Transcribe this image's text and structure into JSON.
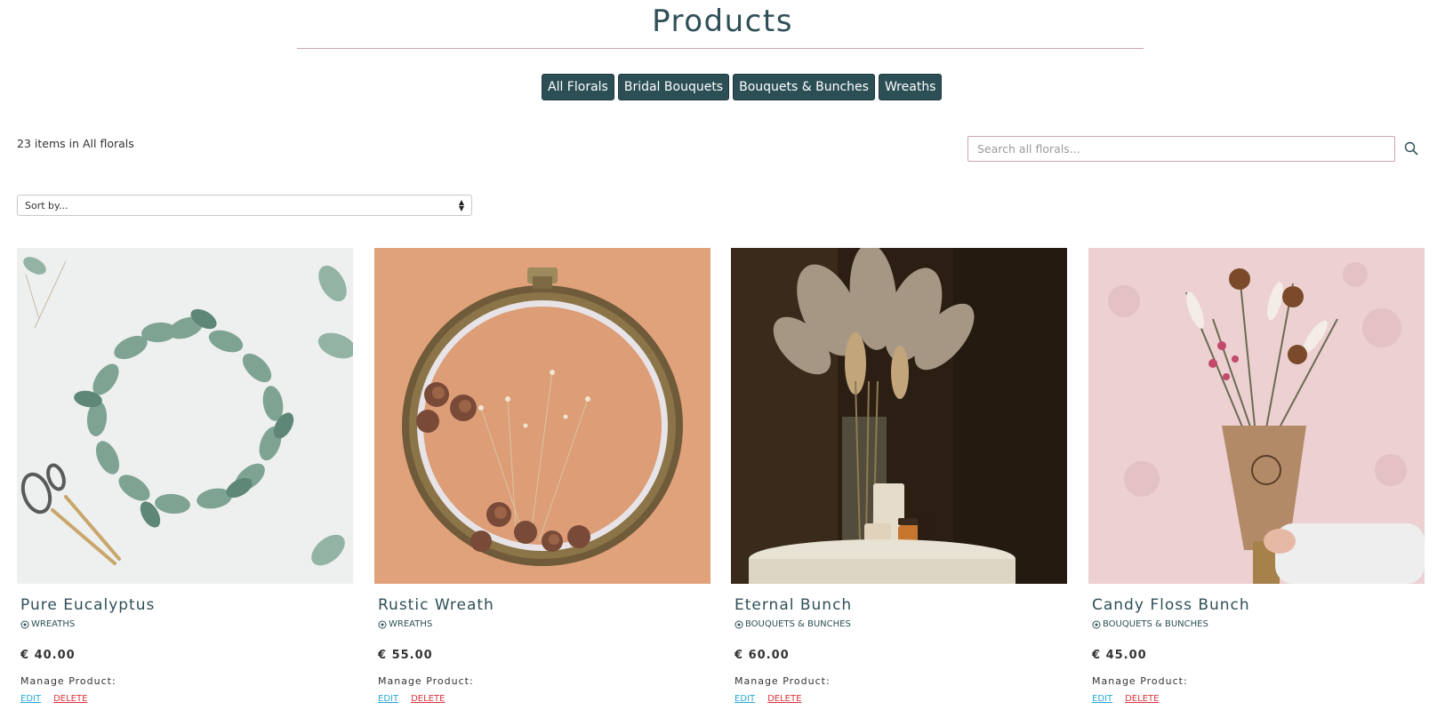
{
  "page": {
    "title": "Products"
  },
  "categories": [
    {
      "label": "All Florals"
    },
    {
      "label": "Bridal Bouquets"
    },
    {
      "label": "Bouquets & Bunches"
    },
    {
      "label": "Wreaths"
    }
  ],
  "toolbar": {
    "item_count_text": "23 items in All florals",
    "search_placeholder": "Search all florals...",
    "sort_label": "Sort by..."
  },
  "products": [
    {
      "name": "Pure Eucalyptus",
      "category": "WREATHS",
      "price": "€ 40.00",
      "manage_label": "Manage Product:",
      "edit_label": "EDIT",
      "delete_label": "DELETE"
    },
    {
      "name": "Rustic Wreath",
      "category": "WREATHS",
      "price": "€ 55.00",
      "manage_label": "Manage Product:",
      "edit_label": "EDIT",
      "delete_label": "DELETE"
    },
    {
      "name": "Eternal Bunch",
      "category": "BOUQUETS & BUNCHES",
      "price": "€ 60.00",
      "manage_label": "Manage Product:",
      "edit_label": "EDIT",
      "delete_label": "DELETE"
    },
    {
      "name": "Candy Floss Bunch",
      "category": "BOUQUETS & BUNCHES",
      "price": "€ 45.00",
      "manage_label": "Manage Product:",
      "edit_label": "EDIT",
      "delete_label": "DELETE"
    }
  ],
  "colors": {
    "primary": "#2c4f56",
    "rule": "#c9a6b1",
    "edit_link": "#2aa9d3",
    "delete_link": "#d9363e"
  },
  "icons": {
    "search": "search-icon",
    "category": "tag-icon",
    "sort": "sort-arrows-icon"
  }
}
